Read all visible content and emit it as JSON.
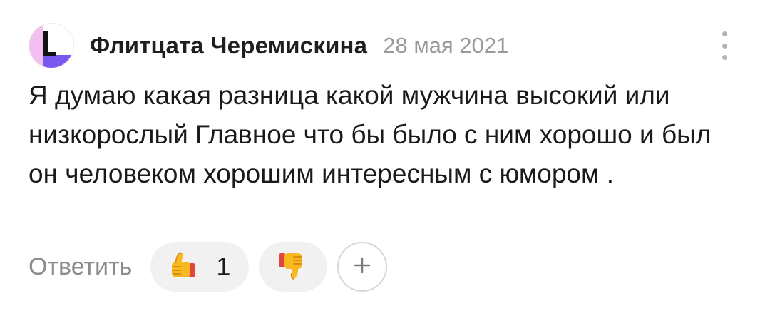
{
  "comment": {
    "author": "Флитцата Черемискина",
    "date": "28 мая 2021",
    "text": "Я думаю какая разница какой мужчина высокий или низкорослый Главное что бы было с ним хорошо и был он человеком хорошим интересным с юмором ."
  },
  "actions": {
    "reply_label": "Ответить",
    "like_count": "1",
    "like_icon": "thumbs-up-emoji",
    "dislike_icon": "thumbs-down-emoji",
    "add_icon": "plus-icon"
  },
  "colors": {
    "author": "#1f1f1f",
    "date": "#9a9a9a",
    "reply": "#8c8c8c",
    "pill_bg": "#f1f1f1",
    "avatar_pink": "#f3bff0",
    "avatar_purple": "#7b57f2"
  }
}
